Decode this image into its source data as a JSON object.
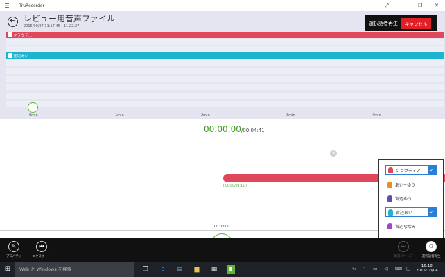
{
  "window": {
    "title": "TruRecorder",
    "controls": {
      "fullscreen": "⤢",
      "minimize": "—",
      "restore": "❐",
      "close": "✕"
    }
  },
  "header": {
    "title": "レビュー用音声ファイル",
    "date_range": "2015/09/27 11:17:46 - 11:22:27",
    "play_selected_label": "選択話者再生",
    "cancel_label": "キャンセル"
  },
  "tracks": [
    {
      "label": "クラウデ...",
      "color": "#e0475b",
      "label_visible": true
    },
    {
      "label": "あいゆう",
      "color": "#f0f1f8",
      "label_visible": false
    },
    {
      "label": "宮辺ゆう",
      "color": "#f0f1f8",
      "label_visible": false
    },
    {
      "label": "宮辺あい",
      "color": "#1eb4d0",
      "label_visible": true
    },
    {
      "label": "宮辺ななみ",
      "color": "#f0f1f8",
      "label_visible": false
    }
  ],
  "timeline": {
    "axis_labels": [
      "0min",
      "1min",
      "2min",
      "3min",
      "4min"
    ]
  },
  "player": {
    "current_time": "00:00:00",
    "total_time": "/00:04:41",
    "segment_label": "( 00:00/00:15 )",
    "cursor_time": "00:00:00"
  },
  "speakers": [
    {
      "name": "クラウディア",
      "color": "#e0475b",
      "selected": true
    },
    {
      "name": "あい+ゆう",
      "color": "#f08c1e",
      "selected": false
    },
    {
      "name": "宮辺ゆう",
      "color": "#5a4fb0",
      "selected": false
    },
    {
      "name": "宮辺あい",
      "color": "#1eb4d0",
      "selected": true
    },
    {
      "name": "宮辺ななみ",
      "color": "#a445c8",
      "selected": false
    }
  ],
  "appbar": {
    "properties_label": "プロパティ",
    "export_label": "エクスポート",
    "silence_skip_label": "無音スキップ",
    "play_selected_label": "選択話者再生"
  },
  "taskbar": {
    "search_placeholder": "Web と Windows を検索",
    "time": "16:18",
    "date": "2015/10/04"
  }
}
